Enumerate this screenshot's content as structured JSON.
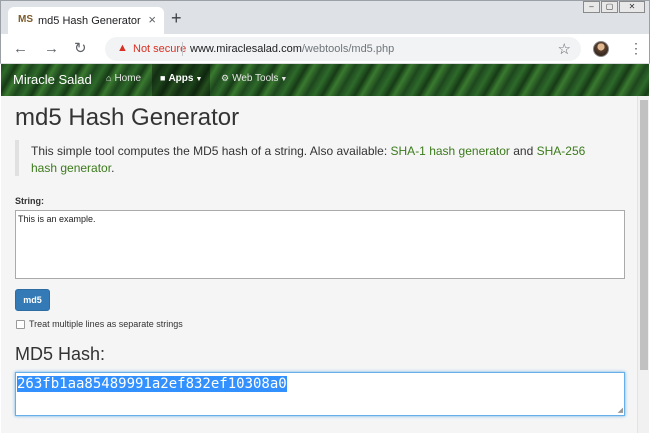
{
  "browser": {
    "tab_title": "md5 Hash Generator",
    "favicon_text": "MS",
    "new_tab": "+",
    "tab_close": "×",
    "security_label": "Not secure",
    "url_host": "www.miraclesalad.com",
    "url_path": "/webtools/md5.php",
    "icons": [
      "back-icon",
      "forward-icon",
      "reload-icon",
      "warning-icon",
      "star-icon",
      "profile-avatar",
      "menu-icon"
    ]
  },
  "site_nav": {
    "brand": "Miracle Salad",
    "items": [
      {
        "label": "Home",
        "icon": "home-icon"
      },
      {
        "label": "Apps",
        "icon": "briefcase-icon",
        "dropdown": true
      },
      {
        "label": "Web Tools",
        "icon": "gears-icon",
        "dropdown": true
      }
    ]
  },
  "page": {
    "title": "md5 Hash Generator",
    "blurb_text": "This simple tool computes the MD5 hash of a string. Also available: ",
    "link_sha1": "SHA-1 hash generator",
    "blurb_and": " and ",
    "link_sha256": "SHA-256 hash generator",
    "blurb_end": ".",
    "string_label": "String:",
    "input_value": "This is an example.",
    "button_label": "md5",
    "checkbox_label": "Treat multiple lines as separate strings",
    "checkbox_checked": false,
    "result_heading": "MD5 Hash:",
    "result_value": "263fb1aa85489991a2ef832ef10308a0"
  },
  "colors": {
    "link": "#3c7a1c",
    "button": "#337ab7",
    "selection": "#3390ff",
    "warning": "#d93025"
  }
}
